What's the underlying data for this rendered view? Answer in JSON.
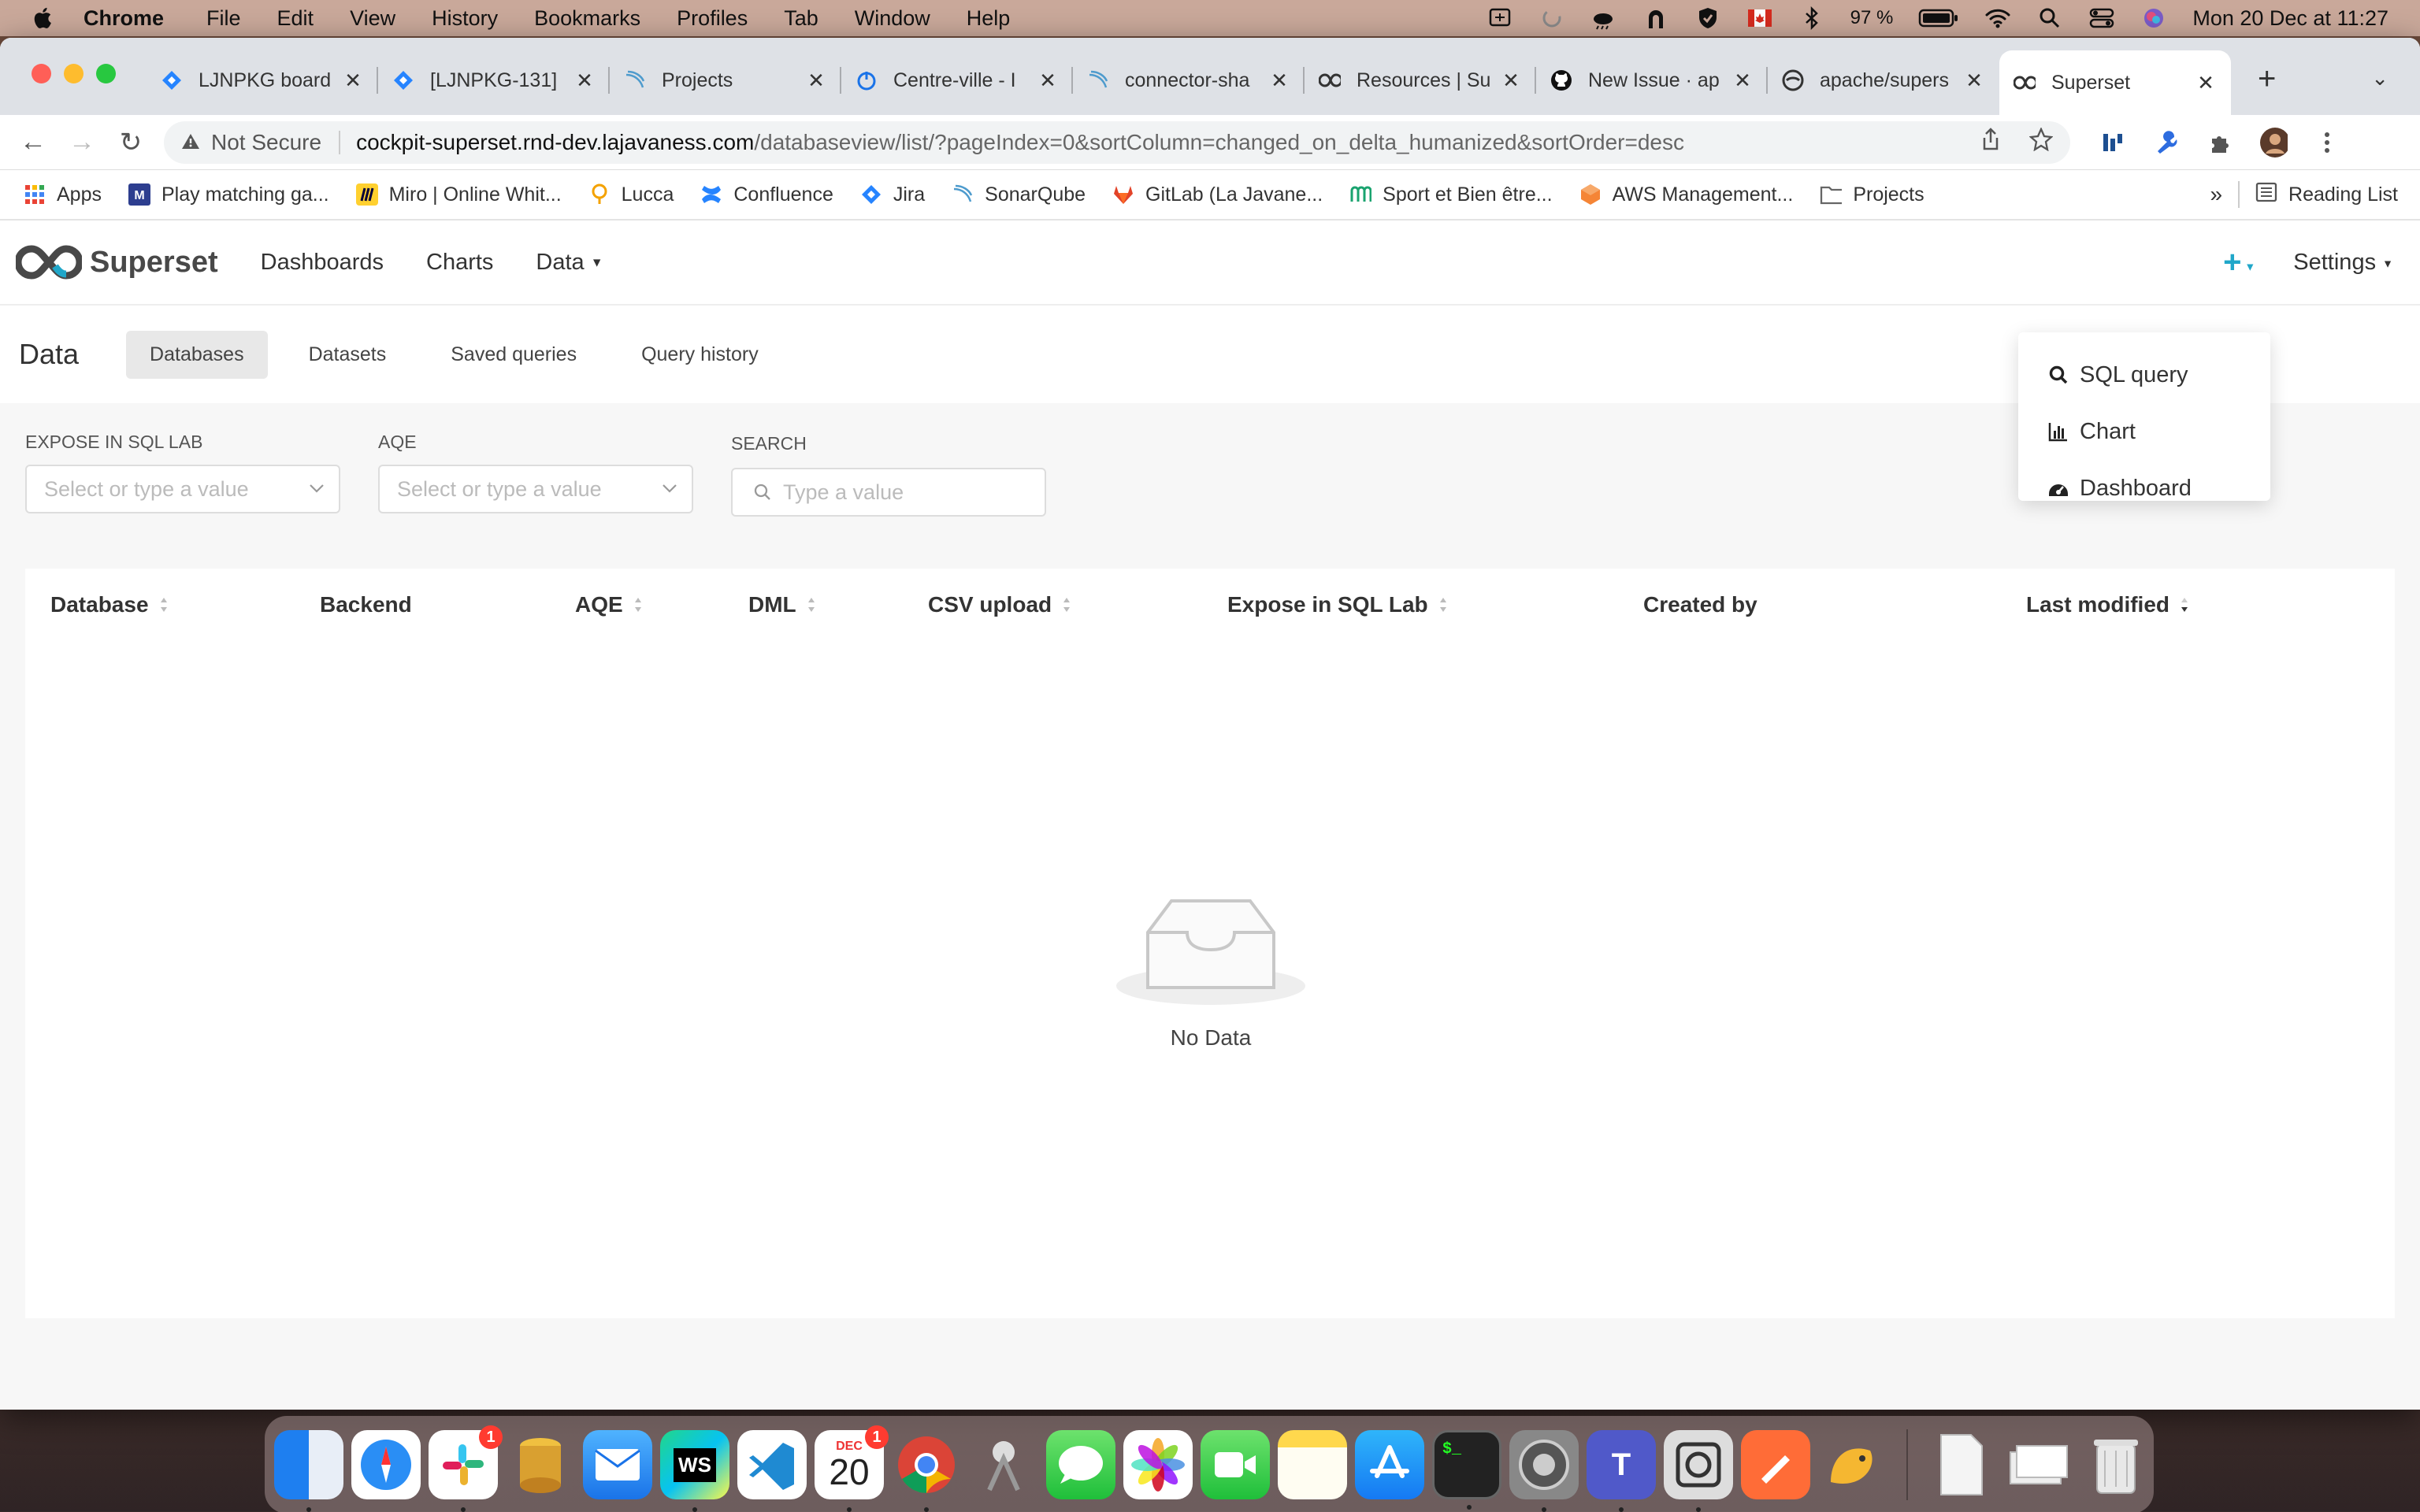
{
  "menubar": {
    "app": "Chrome",
    "items": [
      "File",
      "Edit",
      "View",
      "History",
      "Bookmarks",
      "Profiles",
      "Tab",
      "Window",
      "Help"
    ],
    "battery": "97 %",
    "datetime": "Mon 20 Dec at  11:27"
  },
  "tabs": [
    {
      "title": "LJNPKG board",
      "icon": "jira-icon",
      "color": "#2684ff"
    },
    {
      "title": "[LJNPKG-131]",
      "icon": "jira-icon",
      "color": "#2684ff"
    },
    {
      "title": "Projects",
      "icon": "sonarqube-icon",
      "color": "#4e9bcd"
    },
    {
      "title": "Centre-ville - I",
      "icon": "power-icon",
      "color": "#1a73e8"
    },
    {
      "title": "connector-sha",
      "icon": "sonarqube-icon",
      "color": "#4e9bcd"
    },
    {
      "title": "Resources | Su",
      "icon": "superset-icon",
      "color": "#333"
    },
    {
      "title": "New Issue · ap",
      "icon": "github-icon",
      "color": "#111"
    },
    {
      "title": "apache/supers",
      "icon": "github-icon",
      "color": "#333"
    },
    {
      "title": "Superset",
      "icon": "superset-icon",
      "color": "#333"
    }
  ],
  "address": {
    "warning": "Not Secure",
    "host": "cockpit-superset.rnd-dev.lajavaness.com",
    "path": "/databaseview/list/?pageIndex=0&sortColumn=changed_on_delta_humanized&sortOrder=desc"
  },
  "bookmarks": [
    {
      "label": "Apps",
      "icon": "grid-icon"
    },
    {
      "label": "Play matching ga...",
      "icon": "m-icon"
    },
    {
      "label": "Miro | Online Whit...",
      "icon": "miro-icon"
    },
    {
      "label": "Lucca",
      "icon": "lucca-icon"
    },
    {
      "label": "Confluence",
      "icon": "confluence-icon"
    },
    {
      "label": "Jira",
      "icon": "jira-icon"
    },
    {
      "label": "SonarQube",
      "icon": "sonarqube-icon"
    },
    {
      "label": "GitLab (La Javane...",
      "icon": "gitlab-icon"
    },
    {
      "label": "Sport et Bien être...",
      "icon": "sport-icon"
    },
    {
      "label": "AWS Management...",
      "icon": "aws-icon"
    },
    {
      "label": "Projects",
      "icon": "folder-icon"
    }
  ],
  "bookmarks_more": "»",
  "reading_list": "Reading List",
  "app": {
    "brand": "Superset",
    "nav": {
      "dashboards": "Dashboards",
      "charts": "Charts",
      "data": "Data"
    },
    "settings": "Settings"
  },
  "subnav": {
    "title": "Data",
    "tabs": [
      "Databases",
      "Datasets",
      "Saved queries",
      "Query history"
    ]
  },
  "filters": [
    {
      "label": "EXPOSE IN SQL LAB",
      "placeholder": "Select or type a value"
    },
    {
      "label": "AQE",
      "placeholder": "Select or type a value"
    },
    {
      "label": "SEARCH",
      "placeholder": "Type a value"
    }
  ],
  "table": {
    "columns": [
      "Database",
      "Backend",
      "AQE",
      "DML",
      "CSV upload",
      "Expose in SQL Lab",
      "Created by",
      "Last modified"
    ],
    "empty": "No Data"
  },
  "dropdown": [
    {
      "label": "SQL query",
      "icon": "search-icon"
    },
    {
      "label": "Chart",
      "icon": "bar-chart-icon"
    },
    {
      "label": "Dashboard",
      "icon": "dashboard-icon"
    }
  ],
  "dock": {
    "calendar_month": "DEC",
    "calendar_day": "20",
    "calendar_badge": "1",
    "slack_badge": "1",
    "terminal_text": "$_"
  }
}
